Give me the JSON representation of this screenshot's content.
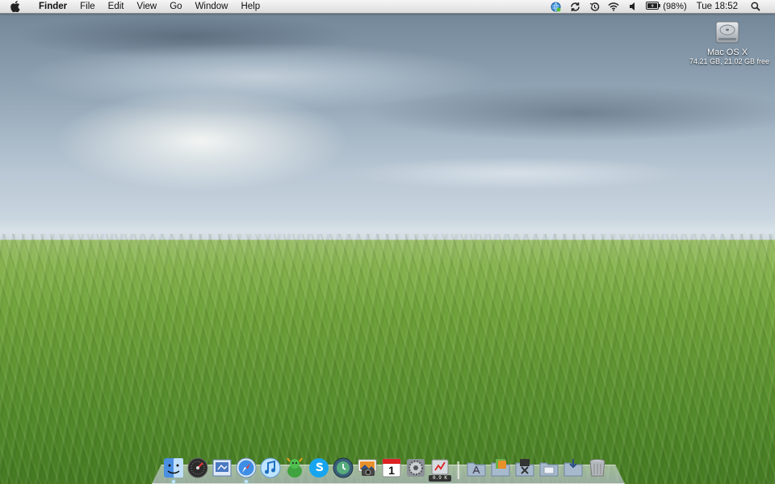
{
  "menubar": {
    "app_name": "Finder",
    "menus": [
      "File",
      "Edit",
      "View",
      "Go",
      "Window",
      "Help"
    ],
    "status": {
      "battery_percent": "(98%)",
      "clock": "Tue 18:52",
      "icons": [
        "globe-sync-icon",
        "sync-icon",
        "time-machine-icon",
        "wifi-icon",
        "volume-icon",
        "battery-icon",
        "spotlight-icon"
      ]
    }
  },
  "desktop": {
    "drive": {
      "name": "Mac OS X",
      "info": "74.21 GB, 21.02 GB free"
    }
  },
  "dock": {
    "apps": [
      {
        "name": "finder",
        "running": true
      },
      {
        "name": "dashboard",
        "running": false
      },
      {
        "name": "mail",
        "running": false
      },
      {
        "name": "safari",
        "running": true
      },
      {
        "name": "itunes",
        "running": false
      },
      {
        "name": "adium",
        "running": false
      },
      {
        "name": "skype",
        "running": false
      },
      {
        "name": "time-machine",
        "running": false
      },
      {
        "name": "iphoto",
        "running": false
      },
      {
        "name": "ical",
        "running": false
      },
      {
        "name": "system-preferences",
        "running": false
      },
      {
        "name": "network-monitor",
        "running": true
      }
    ],
    "calendar_day": "1",
    "network_badge": "0.9 K",
    "stacks": [
      "applications-stack",
      "documents-stack",
      "utilities-stack",
      "folder-stack",
      "downloads-stack",
      "trash"
    ]
  },
  "colors": {
    "menubar_top": "#f6f6f6",
    "menubar_bottom": "#dcdcdc",
    "sky": "#8fa3b4",
    "grass": "#6fa23a"
  }
}
